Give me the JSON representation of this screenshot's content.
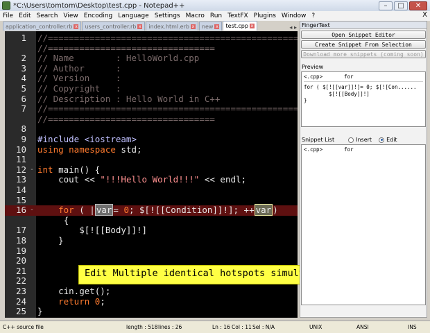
{
  "window": {
    "title": "*C:\\Users\\tomtom\\Desktop\\test.cpp - Notepad++",
    "minimize": "–",
    "maximize": "□",
    "close": "✕"
  },
  "menu": [
    "File",
    "Edit",
    "Search",
    "View",
    "Encoding",
    "Language",
    "Settings",
    "Macro",
    "Run",
    "TextFX",
    "Plugins",
    "Window",
    "?"
  ],
  "menu_close": "X",
  "tabs": [
    {
      "label": "application_controller.rb",
      "active": false
    },
    {
      "label": "users_controller.rb",
      "active": false
    },
    {
      "label": "index.html.erb",
      "active": false
    },
    {
      "label": "new",
      "active": false
    },
    {
      "label": "test.cpp",
      "active": true
    }
  ],
  "tab_arrows": "◂ ▸",
  "editor": {
    "lines": [
      {
        "n": "1",
        "parts": [
          {
            "t": "//========================================================================================",
            "c": "comment"
          }
        ]
      },
      {
        "n": "",
        "parts": [
          {
            "t": "//================================",
            "c": "comment"
          }
        ]
      },
      {
        "n": "2",
        "parts": [
          {
            "t": "// Name        : HelloWorld.cpp",
            "c": "comment"
          }
        ]
      },
      {
        "n": "3",
        "parts": [
          {
            "t": "// Author      :",
            "c": "comment"
          }
        ]
      },
      {
        "n": "4",
        "parts": [
          {
            "t": "// Version     :",
            "c": "comment"
          }
        ]
      },
      {
        "n": "5",
        "parts": [
          {
            "t": "// Copyright   :",
            "c": "comment"
          }
        ]
      },
      {
        "n": "6",
        "parts": [
          {
            "t": "// Description : Hello World in C++",
            "c": "comment"
          }
        ]
      },
      {
        "n": "7",
        "parts": [
          {
            "t": "//========================================================================================",
            "c": "comment"
          }
        ]
      },
      {
        "n": "",
        "parts": [
          {
            "t": "//================================",
            "c": "comment"
          }
        ]
      },
      {
        "n": "8",
        "parts": []
      },
      {
        "n": "9",
        "parts": [
          {
            "t": "#include <iostream>",
            "c": "dir"
          }
        ]
      },
      {
        "n": "10",
        "parts": [
          {
            "t": "using ",
            "c": "kw"
          },
          {
            "t": "namespace ",
            "c": "kw"
          },
          {
            "t": "std;",
            "c": "std"
          }
        ]
      },
      {
        "n": "11",
        "parts": []
      },
      {
        "n": "12",
        "fold": "-",
        "parts": [
          {
            "t": "int ",
            "c": "kw"
          },
          {
            "t": "main() {",
            "c": "def"
          }
        ]
      },
      {
        "n": "13",
        "parts": [
          {
            "t": "    cout << ",
            "c": "def"
          },
          {
            "t": "\"!!!Hello World!!!\"",
            "c": "str"
          },
          {
            "t": " << endl;",
            "c": "def"
          }
        ]
      },
      {
        "n": "14",
        "parts": []
      },
      {
        "n": "15",
        "parts": []
      },
      {
        "n": "16",
        "fold": "-",
        "hl": true,
        "parts": [
          {
            "t": "    for ",
            "c": "kw"
          },
          {
            "t": "( ",
            "c": "def"
          },
          {
            "t": "|",
            "c": "caret"
          },
          {
            "t": "var",
            "c": "hot"
          },
          {
            "t": "= ",
            "c": "def"
          },
          {
            "t": "0",
            "c": "num"
          },
          {
            "t": "; $[![[Condition]]!]; ++",
            "c": "def"
          },
          {
            "t": "var",
            "c": "hotsel"
          },
          {
            "t": ")",
            "c": "def"
          }
        ]
      },
      {
        "n": "",
        "parts": [
          {
            "t": "     {",
            "c": "def"
          }
        ]
      },
      {
        "n": "17",
        "parts": [
          {
            "t": "        $[![[Body]]!]",
            "c": "def"
          }
        ]
      },
      {
        "n": "18",
        "parts": [
          {
            "t": "    }",
            "c": "def"
          }
        ]
      },
      {
        "n": "19",
        "parts": []
      },
      {
        "n": "20",
        "parts": []
      },
      {
        "n": "21",
        "parts": []
      },
      {
        "n": "22",
        "parts": []
      },
      {
        "n": "23",
        "parts": [
          {
            "t": "    cin.get();",
            "c": "def"
          }
        ]
      },
      {
        "n": "24",
        "parts": [
          {
            "t": "    return ",
            "c": "kw"
          },
          {
            "t": "0",
            "c": "num"
          },
          {
            "t": ";",
            "c": "def"
          }
        ]
      },
      {
        "n": "25",
        "parts": [
          {
            "t": "}",
            "c": "def"
          }
        ]
      }
    ]
  },
  "tooltip": {
    "text": "Edit Multiple identical hotspots simultaneously",
    "close": "+"
  },
  "panel": {
    "title": "FingerText",
    "buttons": {
      "open_editor": "Open Snippet Editor",
      "create_from_selection": "Create Snippet From Selection",
      "download": "Download more snippets (coming soon)"
    },
    "preview_label": "Preview",
    "preview_ext": "<.cpp>",
    "preview_name": "for",
    "preview_code": "for ( $[![[var]]!]= 0; $[![Con......\n        $[![[Body]]!]\n}",
    "snippet_list_label": "Snippet List",
    "radio_insert": "Insert",
    "radio_edit": "Edit",
    "list_items": [
      {
        "ext": "<.cpp>",
        "name": "for"
      }
    ]
  },
  "status": {
    "file_type": "C++ source file",
    "length": "length : 518",
    "lines": "lines : 26",
    "ln": "Ln : 16",
    "col": "Col : 11",
    "sel": "Sel : N/A",
    "eol": "UNIX",
    "encoding": "ANSI",
    "mode": "INS"
  },
  "colors": {
    "editor_bg": "#000000",
    "gutter_bg": "#2a2a2a",
    "comment": "#7a6a6a",
    "keyword": "#ff7b2f",
    "string": "#ff9090",
    "highlight_line": "#5e1010",
    "tooltip_bg": "#ffff44"
  }
}
